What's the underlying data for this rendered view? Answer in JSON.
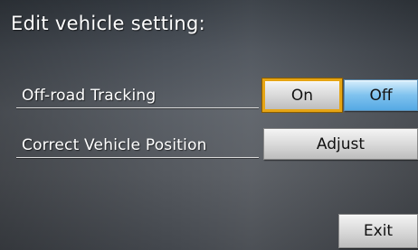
{
  "title": "Edit vehicle setting:",
  "rows": [
    {
      "label": "Off-road Tracking",
      "options": [
        "On",
        "Off"
      ],
      "selected": "Off",
      "cursor_on": "On"
    },
    {
      "label": "Correct Vehicle Position",
      "button": "Adjust"
    }
  ],
  "exit_label": "Exit",
  "colors": {
    "selected_option": "#55a9e4",
    "focus_outline": "#e6a515",
    "button_face": "#d7d7d7",
    "text": "#ffffff"
  }
}
